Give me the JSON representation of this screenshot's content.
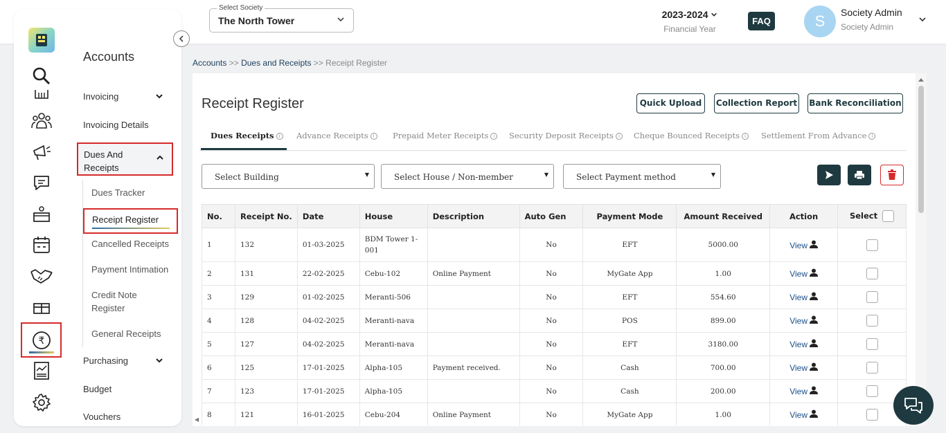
{
  "header": {
    "society_label": "Select Society",
    "society_value": "The North Tower",
    "financial_year": "2023-2024",
    "financial_year_label": "Financial Year",
    "faq": "FAQ",
    "avatar_letter": "S",
    "user_name": "Society Admin",
    "user_role": "Society Admin"
  },
  "sidebar": {
    "title": "Accounts",
    "items": {
      "invoicing": "Invoicing",
      "invoicing_details": "Invoicing Details",
      "dues_and_receipts": "Dues And Receipts",
      "purchasing": "Purchasing",
      "budget": "Budget",
      "vouchers": "Vouchers"
    },
    "sub_items": {
      "dues_tracker": "Dues Tracker",
      "receipt_register": "Receipt Register",
      "cancelled_receipts": "Cancelled Receipts",
      "payment_intimation": "Payment Intimation",
      "credit_note_register": "Credit Note Register",
      "general_receipts": "General Receipts"
    },
    "rail_icons": [
      "logo-icon",
      "search-icon",
      "building-icon",
      "community-icon",
      "megaphone-icon",
      "chat-icon",
      "delivery-icon",
      "calendar-icon",
      "handshake-icon",
      "gift-icon",
      "rupee-icon",
      "report-icon",
      "settings-icon"
    ]
  },
  "breadcrumb": {
    "accounts": "Accounts",
    "sep1": ">>",
    "dues_and_receipts": "Dues and Receipts",
    "sep2": ">>",
    "current": "Receipt Register"
  },
  "page": {
    "title": "Receipt Register",
    "buttons": {
      "quick_upload": "Quick Upload",
      "collection_report": "Collection Report",
      "bank_reconciliation": "Bank Reconciliation"
    },
    "tabs": [
      "Dues Receipts",
      "Advance Receipts",
      "Prepaid Meter Receipts",
      "Security Deposit Receipts",
      "Cheque Bounced Receipts",
      "Settlement From Advance"
    ],
    "filters": {
      "building": "Select Building",
      "house": "Select House / Non-member",
      "payment_method": "Select Payment method"
    }
  },
  "table": {
    "headers": {
      "no": "No.",
      "receipt_no": "Receipt No.",
      "date": "Date",
      "house": "House",
      "description": "Description",
      "auto_gen": "Auto Gen",
      "payment_mode": "Payment Mode",
      "amount": "Amount Received",
      "action": "Action",
      "select": "Select"
    },
    "view_label": "View",
    "rows": [
      {
        "no": "1",
        "receipt": "132",
        "date": "01-03-2025",
        "house": "BDM Tower 1-001",
        "desc": "",
        "auto": "No",
        "mode": "EFT",
        "amount": "5000.00"
      },
      {
        "no": "2",
        "receipt": "131",
        "date": "22-02-2025",
        "house": "Cebu-102",
        "desc": "Online Payment",
        "auto": "No",
        "mode": "MyGate App",
        "amount": "1.00"
      },
      {
        "no": "3",
        "receipt": "129",
        "date": "01-02-2025",
        "house": "Meranti-506",
        "desc": "",
        "auto": "No",
        "mode": "EFT",
        "amount": "554.60"
      },
      {
        "no": "4",
        "receipt": "128",
        "date": "04-02-2025",
        "house": "Meranti-nava",
        "desc": "",
        "auto": "No",
        "mode": "POS",
        "amount": "899.00"
      },
      {
        "no": "5",
        "receipt": "127",
        "date": "04-02-2025",
        "house": "Meranti-nava",
        "desc": "",
        "auto": "No",
        "mode": "EFT",
        "amount": "3180.00"
      },
      {
        "no": "6",
        "receipt": "125",
        "date": "17-01-2025",
        "house": "Alpha-105",
        "desc": "Payment received.",
        "auto": "No",
        "mode": "Cash",
        "amount": "700.00"
      },
      {
        "no": "7",
        "receipt": "123",
        "date": "17-01-2025",
        "house": "Alpha-105",
        "desc": "",
        "auto": "No",
        "mode": "Cash",
        "amount": "200.00"
      },
      {
        "no": "8",
        "receipt": "121",
        "date": "16-01-2025",
        "house": "Cebu-204",
        "desc": "Online Payment",
        "auto": "No",
        "mode": "MyGate App",
        "amount": "1.00"
      }
    ]
  },
  "colors": {
    "primary": "#1e3a40",
    "highlight_border": "#d62a2a",
    "link": "#1a4f8a"
  }
}
